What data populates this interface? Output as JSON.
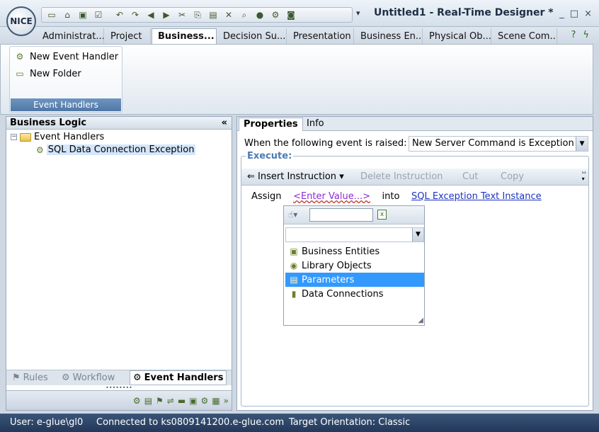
{
  "app": {
    "logo_text": "NICE",
    "title": "Untitled1 - Real-Time Designer *",
    "window_buttons": [
      "_",
      "□",
      "×"
    ]
  },
  "quick_access": {
    "icons": [
      "new-icon",
      "open-icon",
      "save-icon",
      "save-check-icon",
      "undo-icon",
      "redo-icon",
      "back-icon",
      "forward-icon",
      "cut-icon",
      "copy-icon",
      "paste-icon",
      "delete-icon",
      "find-icon",
      "run-icon",
      "debug-icon",
      "screenshot-icon"
    ],
    "more": "▾"
  },
  "ribbon_tabs": [
    {
      "label": "Administrat...",
      "active": false
    },
    {
      "label": "Project",
      "active": false
    },
    {
      "label": "Business...",
      "active": true
    },
    {
      "label": "Decision Su...",
      "active": false
    },
    {
      "label": "Presentation",
      "active": false
    },
    {
      "label": "Business En...",
      "active": false
    },
    {
      "label": "Physical Ob...",
      "active": false
    },
    {
      "label": "Scene Com...",
      "active": false
    }
  ],
  "ribbon": {
    "group_label": "Event Handlers",
    "buttons": [
      {
        "label": "New Event Handler",
        "icon": "event-handler-icon"
      },
      {
        "label": "New Folder",
        "icon": "new-folder-icon"
      }
    ]
  },
  "left_pane": {
    "title": "Business Logic",
    "collapse": "«",
    "tree": [
      {
        "label": "Event Handlers",
        "expander": "−",
        "type": "folder"
      },
      {
        "label": "SQL Data Connection Exception",
        "type": "handler",
        "selected": true
      }
    ],
    "bottom_tabs": [
      {
        "label": "Rules",
        "active": false
      },
      {
        "label": "Workflow",
        "active": false
      },
      {
        "label": "Event Handlers",
        "active": true
      }
    ]
  },
  "right_pane": {
    "tabs": [
      {
        "label": "Properties",
        "active": true
      },
      {
        "label": "Info",
        "active": false
      }
    ],
    "event_label": "When the following event is raised:",
    "event_value": "New Server Command is Exception",
    "execute_label": "Execute:",
    "toolbar": {
      "insert": "Insert Instruction",
      "delete": "Delete Instruction",
      "cut": "Cut",
      "copy": "Copy"
    },
    "assign": {
      "keyword": "Assign",
      "value_link": "<Enter Value...>",
      "into": "into",
      "target_link": "SQL Exception Text Instance"
    }
  },
  "popup": {
    "search_value": "",
    "combo_value": "",
    "items": [
      {
        "label": "Business Entities",
        "selected": false
      },
      {
        "label": "Library Objects",
        "selected": false
      },
      {
        "label": "Parameters",
        "selected": true
      },
      {
        "label": "Data Connections",
        "selected": false
      }
    ]
  },
  "status": {
    "user": "User: e-glue\\gl0",
    "connection": "Connected to ks0809141200.e-glue.com",
    "orientation": "Target Orientation: Classic"
  },
  "colors": {
    "accent": "#4f77a6",
    "selection": "#3399ff",
    "link": "#1d33c4",
    "status_bar": "#2a4266"
  }
}
